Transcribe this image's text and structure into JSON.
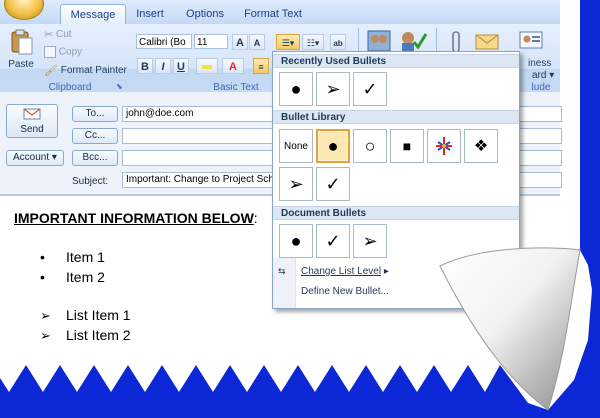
{
  "tabs": [
    "Message",
    "Insert",
    "Options",
    "Format Text"
  ],
  "clipboard": {
    "paste": "Paste",
    "cut": "Cut",
    "copy": "Copy",
    "format_painter": "Format Painter",
    "group_label": "Clipboard"
  },
  "basic_text": {
    "font": "Calibri (Bo",
    "size": "11",
    "group_label": "Basic Text",
    "bold": "B",
    "italic": "I",
    "underline": "U",
    "grow": "A",
    "shrink": "A"
  },
  "ribbon_right": {
    "partial_label_1": "iness",
    "partial_label_2": "ard",
    "partial_group": "lude"
  },
  "header": {
    "send": "Send",
    "account": "Account",
    "to_button": "To...",
    "cc_button": "Cc...",
    "bcc_button": "Bcc...",
    "to_value": "john@doe.com",
    "cc_value": "",
    "bcc_value": "",
    "subject_label": "Subject:",
    "subject_value": "Important:  Change to Project Sche"
  },
  "body": {
    "heading": "IMPORTANT INFORMATION BELOW",
    "heading_suffix": ":",
    "bullet_items": [
      "Item 1",
      "Item 2"
    ],
    "arrow_items": [
      "List Item 1",
      "List Item 2"
    ]
  },
  "bullet_menu": {
    "recently_used_title": "Recently Used Bullets",
    "library_title": "Bullet Library",
    "document_title": "Document Bullets",
    "none_label": "None",
    "recent": [
      "bullet-dot",
      "arrow-bullet",
      "check-bullet"
    ],
    "library": [
      "none",
      "bullet-dot",
      "circle-bullet",
      "square-bullet",
      "star-bullet",
      "diamond-bullet",
      "arrow-bullet",
      "check-bullet"
    ],
    "document": [
      "bullet-dot",
      "check-bullet",
      "arrow-bullet"
    ],
    "change_level": "Change List Level",
    "define_new": "Define New Bullet...",
    "selected": "bullet-dot"
  },
  "colors": {
    "highlight_yellow": "#f7e23a",
    "font_red": "#e2261e",
    "backdrop_blue": "#0b27d6",
    "selection_orange": "#e0a33b"
  }
}
